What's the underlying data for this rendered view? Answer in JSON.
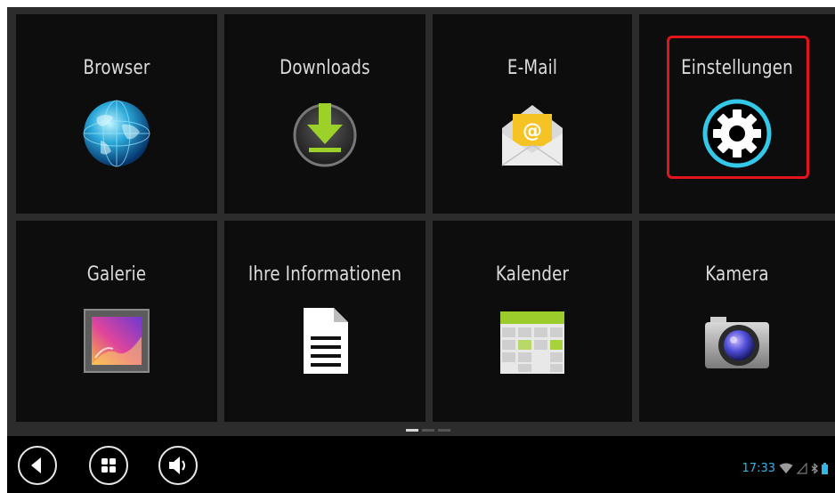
{
  "apps": [
    {
      "label": "Browser",
      "icon": "globe-icon"
    },
    {
      "label": "Downloads",
      "icon": "download-icon"
    },
    {
      "label": "E-Mail",
      "icon": "email-envelope-icon"
    },
    {
      "label": "Einstellungen",
      "icon": "settings-gear-icon",
      "highlighted": true
    },
    {
      "label": "Galerie",
      "icon": "gallery-picture-icon"
    },
    {
      "label": "Ihre Informationen",
      "icon": "document-icon"
    },
    {
      "label": "Kalender",
      "icon": "calendar-icon"
    },
    {
      "label": "Kamera",
      "icon": "camera-icon"
    }
  ],
  "pager": {
    "pages": 3,
    "current": 1
  },
  "navbar": {
    "buttons": [
      "back-icon",
      "apps-grid-icon",
      "volume-icon"
    ]
  },
  "status_bar": {
    "time": "17:33",
    "icons": [
      "wifi-icon",
      "signal-icon",
      "bluetooth-icon",
      "battery-icon"
    ]
  },
  "colors": {
    "tile_bg": "#0d0d0d",
    "divider": "#2c2c2c",
    "highlight": "#e3141c",
    "accent": "#33b5e5"
  }
}
